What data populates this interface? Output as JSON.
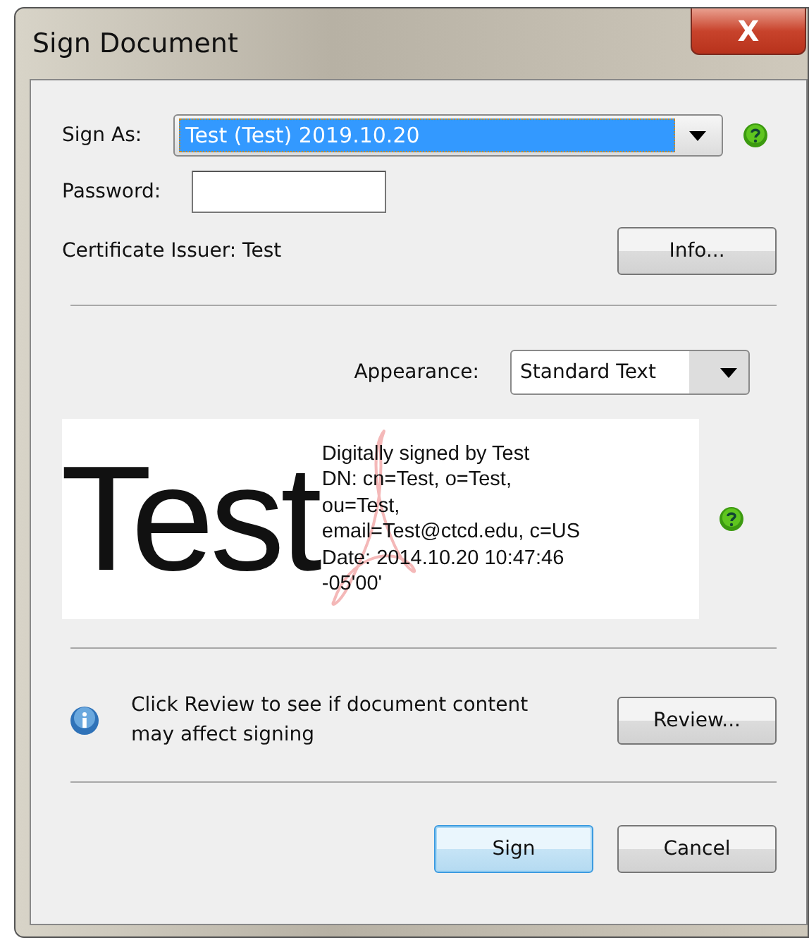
{
  "window": {
    "title": "Sign Document",
    "close": "X"
  },
  "sign_as": {
    "label": "Sign As:",
    "value": "Test (Test) 2019.10.20",
    "selected": true
  },
  "password": {
    "label": "Password:"
  },
  "certificate_issuer": "Certificate Issuer: Test",
  "info_button": "Info...",
  "appearance": {
    "label": "Appearance:",
    "value": "Standard Text"
  },
  "preview": {
    "name": "Test",
    "details": [
      "Digitally signed by Test",
      "DN: cn=Test, o=Test,",
      "ou=Test,",
      "email=Test@ctcd.edu, c=US",
      "Date: 2014.10.20 10:47:46",
      "-05'00'"
    ]
  },
  "review": {
    "message": "Click Review to see if document content may affect signing",
    "button": "Review..."
  },
  "buttons": [
    {
      "label": "Sign",
      "default": true
    },
    {
      "label": "Cancel",
      "default": false
    }
  ]
}
